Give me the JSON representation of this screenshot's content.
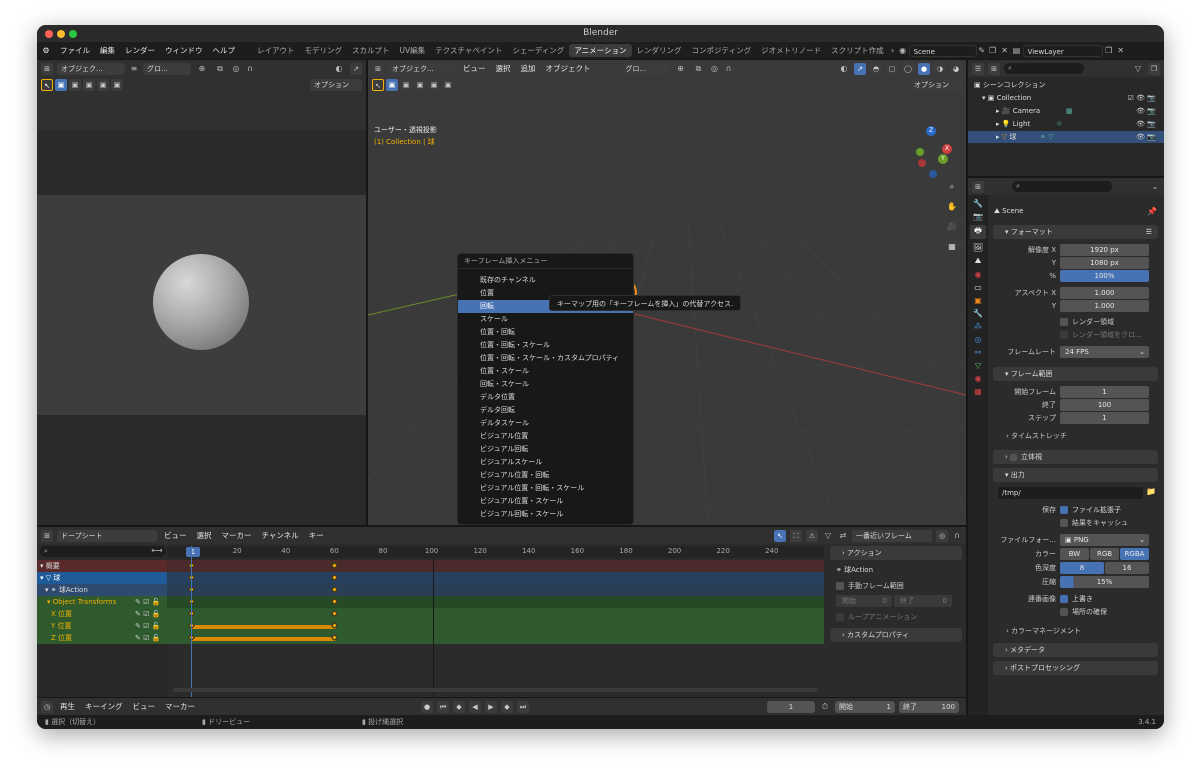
{
  "window": {
    "title": "Blender"
  },
  "menubar": {
    "items": [
      "ファイル",
      "編集",
      "レンダー",
      "ウィンドウ",
      "ヘルプ"
    ],
    "workspaces": [
      "レイアウト",
      "モデリング",
      "スカルプト",
      "UV編集",
      "テクスチャペイント",
      "シェーディング",
      "アニメーション",
      "レンダリング",
      "コンポジティング",
      "ジオメトリノード",
      "スクリプト作成"
    ],
    "active_workspace": "アニメーション",
    "scene": "Scene",
    "view_layer": "ViewLayer"
  },
  "camera_view": {
    "object_mode": "オブジェク...",
    "transform": "グロ...",
    "options": "オプション"
  },
  "viewport": {
    "object_mode": "オブジェク...",
    "menus": [
      "ビュー",
      "選択",
      "追加",
      "オブジェクト"
    ],
    "transform": "グロ...",
    "options": "オプション",
    "overlay_title": "ユーザー・透視投影",
    "overlay_collection": "(1) Collection | 球",
    "gizmo": {
      "x": "X",
      "y": "Y",
      "z": "Z"
    }
  },
  "keyframe_menu": {
    "title": "キーフレーム挿入メニュー",
    "items": [
      "既存のチャンネル",
      "位置",
      "回転",
      "スケール",
      "位置・回転",
      "位置・回転・スケール",
      "位置・回転・スケール・カスタムプロパティ",
      "位置・スケール",
      "回転・スケール",
      "デルタ位置",
      "デルタ回転",
      "デルタスケール",
      "ビジュアル位置",
      "ビジュアル回転",
      "ビジュアルスケール",
      "ビジュアル位置・回転",
      "ビジュアル位置・回転・スケール",
      "ビジュアル位置・スケール",
      "ビジュアル回転・スケール"
    ],
    "highlighted": "回転",
    "tooltip": "キーマップ用の「キーフレームを挿入」の代替アクセス."
  },
  "dopesheet": {
    "mode": "ドープシート",
    "menus": [
      "ビュー",
      "選択",
      "マーカー",
      "チャンネル",
      "キー"
    ],
    "snap": "一番近いフレーム",
    "current_frame": "1",
    "ruler": [
      "20",
      "40",
      "60",
      "80",
      "100",
      "120",
      "140",
      "160",
      "180",
      "200",
      "220",
      "240"
    ],
    "channels": [
      {
        "label": "概要",
        "color": "#e04848"
      },
      {
        "label": "球",
        "color": "#fff"
      },
      {
        "label": "球Action",
        "color": "#ddd"
      },
      {
        "label": "Object Transforms",
        "color": "#f2b100"
      },
      {
        "label": "X 位置",
        "color": "#f2b100"
      },
      {
        "label": "Y 位置",
        "color": "#f2b100"
      },
      {
        "label": "Z 位置",
        "color": "#f2b100"
      }
    ],
    "action_panel": {
      "title": "アクション",
      "action_name": "球Action",
      "manual_range": "手動フレーム範囲",
      "start_label": "開始",
      "start": "0",
      "end_label": "終了",
      "end": "0",
      "loop": "ループアニメーション",
      "custom_props": "カスタムプロパティ"
    }
  },
  "timeline": {
    "menus": [
      "再生",
      "キーイング",
      "ビュー",
      "マーカー"
    ],
    "frame": "1",
    "start_label": "開始",
    "start": "1",
    "end_label": "終了",
    "end": "100"
  },
  "statusbar": {
    "select": "選択（切替え）",
    "pan": "ドリービュー",
    "menu": "投げ縄選択",
    "version": "3.4.1"
  },
  "outliner": {
    "root": "シーンコレクション",
    "collection": "Collection",
    "objects": [
      "Camera",
      "Light",
      "球"
    ]
  },
  "properties": {
    "scene": "Scene",
    "format": {
      "title": "フォーマット",
      "res_x_label": "解像度 X",
      "res_x": "1920 px",
      "res_y_label": "Y",
      "res_y": "1080 px",
      "pct_label": "%",
      "pct": "100%",
      "aspect_x_label": "アスペクト X",
      "aspect_x": "1.000",
      "aspect_y_label": "Y",
      "aspect_y": "1.000",
      "render_region": "レンダー領域",
      "crop": "レンダー領域をクロ...",
      "fps_label": "フレームレート",
      "fps": "24 FPS"
    },
    "frame_range": {
      "title": "フレーム範囲",
      "start_label": "開始フレーム",
      "start": "1",
      "end_label": "終了",
      "end": "100",
      "step_label": "ステップ",
      "step": "1",
      "time_stretch": "タイムストレッチ"
    },
    "stereo": "立体視",
    "output": {
      "title": "出力",
      "path": "/tmp/",
      "save_label": "保存",
      "file_ext": "ファイル拡張子",
      "cache": "結果をキャッシュ",
      "format_label": "ファイルフォー...",
      "format": "PNG",
      "color_label": "カラー",
      "color_opts": [
        "BW",
        "RGB",
        "RGBA"
      ],
      "color_active": "RGBA",
      "depth_label": "色深度",
      "depth_opts": [
        "8",
        "16"
      ],
      "compress_label": "圧縮",
      "compress": "15%",
      "seq_label": "連番画像",
      "overwrite": "上書き",
      "placeholders": "場所の確保",
      "color_mgmt": "カラーマネージメント"
    },
    "metadata": "メタデータ",
    "postproc": "ポストプロセッシング"
  },
  "colors": {
    "accent": "#4772b3",
    "keyframe": "#f2b100",
    "bg": "#303030"
  }
}
